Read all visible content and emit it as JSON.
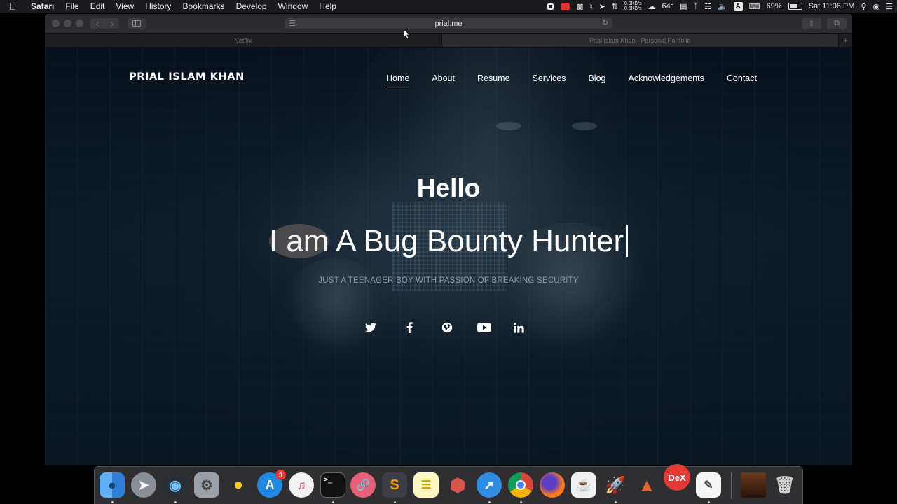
{
  "menubar": {
    "app": "Safari",
    "items": [
      "File",
      "Edit",
      "View",
      "History",
      "Bookmarks",
      "Develop",
      "Window",
      "Help"
    ],
    "net_up": "0.0KB/s",
    "net_down": "0.5KB/s",
    "temperature": "64°",
    "battery": "69%",
    "battery_level": 0.69,
    "clock": "Sat 11:06 PM",
    "input_key": "A"
  },
  "browser": {
    "url": "prial.me",
    "tabs": [
      {
        "title": "Netflix",
        "active": false
      },
      {
        "title": "Prial Islam Khan - Personal Portfolio",
        "active": true
      }
    ]
  },
  "site": {
    "brand": "PRIAL ISLAM KHAN",
    "nav": [
      "Home",
      "About",
      "Resume",
      "Services",
      "Blog",
      "Acknowledgements",
      "Contact"
    ],
    "active_nav": "Home",
    "hero": {
      "greeting": "Hello",
      "prefix": "I am",
      "typed": "A Bug Bounty Hunter",
      "tagline": "JUST A TEENAGER BOY WITH PASSION OF BREAKING SECURITY"
    },
    "socials": [
      "twitter-icon",
      "facebook-icon",
      "globe-icon",
      "youtube-icon",
      "linkedin-icon"
    ]
  },
  "dock": {
    "apps": [
      {
        "name": "finder",
        "label": ""
      },
      {
        "name": "launchpad",
        "label": ""
      },
      {
        "name": "quicktime",
        "label": ""
      },
      {
        "name": "system-preferences",
        "label": ""
      },
      {
        "name": "cyberduck",
        "label": ""
      },
      {
        "name": "app-store",
        "label": "",
        "badge": "3"
      },
      {
        "name": "itunes",
        "label": ""
      },
      {
        "name": "terminal",
        "label": ">_"
      },
      {
        "name": "link-app",
        "label": ""
      },
      {
        "name": "sublime-text",
        "label": "S"
      },
      {
        "name": "notes",
        "label": ""
      },
      {
        "name": "virtual-machine",
        "label": ""
      },
      {
        "name": "safari",
        "label": ""
      },
      {
        "name": "chrome",
        "label": ""
      },
      {
        "name": "firefox",
        "label": ""
      },
      {
        "name": "java",
        "label": ""
      },
      {
        "name": "rocket-app",
        "label": ""
      },
      {
        "name": "triangle-app",
        "label": ""
      },
      {
        "name": "dex",
        "label": "DeX"
      },
      {
        "name": "textedit",
        "label": ""
      },
      {
        "name": "downloads-stack",
        "label": ""
      },
      {
        "name": "trash",
        "label": ""
      }
    ]
  }
}
